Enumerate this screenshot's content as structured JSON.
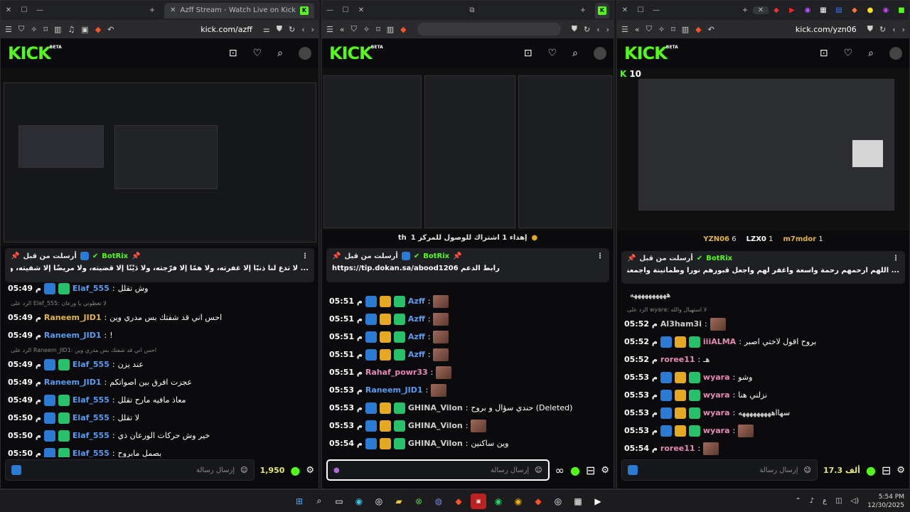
{
  "windows": [
    {
      "tab_title": "Azff Stream - Watch Live on Kick",
      "url": "kick.com/azff",
      "pinned": {
        "label": "أرسلت من قبل",
        "bot": "BotRix",
        "message": "... لا تدع لنا ذنبًا إلا غفرته، ولا همًا إلا فرّجته، ولا دَيْنًا إلا قضيته، ولا مريضًا إلا شفيته، ولا مبتلى إلا عافيته، يا أكرم الأكرمين"
      },
      "chat": [
        {
          "time": "05:49 م",
          "user": "Elaf_555",
          "ucls": "u-blue",
          "badges": [
            "b-blue",
            "b-green"
          ],
          "text": "وش تقلل"
        },
        {
          "reply": "الرد على Elaf_555: لا تعطوني يا ورعان"
        },
        {
          "time": "05:49 م",
          "user": "Raneem_JID1",
          "ucls": "u-gold",
          "badges": [],
          "text": "احس اني قد شفتك بس مدري وين"
        },
        {
          "time": "05:49 م",
          "user": "Raneem_JID1",
          "ucls": "u-blue",
          "badges": [],
          "text": "!"
        },
        {
          "reply": "الرد على Raneem_JID1: احس اني قد شفتك بس مدري وين"
        },
        {
          "time": "05:49 م",
          "user": "Elaf_555",
          "ucls": "u-blue",
          "badges": [
            "b-blue",
            "b-green"
          ],
          "text": "عند يزن"
        },
        {
          "time": "05:49 م",
          "user": "Raneem_JID1",
          "ucls": "u-blue",
          "badges": [],
          "text": "عجزت افرق بين اصواتكم"
        },
        {
          "time": "05:49 م",
          "user": "Elaf_555",
          "ucls": "u-blue",
          "badges": [
            "b-blue",
            "b-green"
          ],
          "text": "معاذ مافيه مارح تقلل"
        },
        {
          "time": "05:50 م",
          "user": "Elaf_555",
          "ucls": "u-blue",
          "badges": [
            "b-blue",
            "b-green"
          ],
          "text": "لا تقلل"
        },
        {
          "time": "05:50 م",
          "user": "Elaf_555",
          "ucls": "u-blue",
          "badges": [
            "b-blue",
            "b-green"
          ],
          "text": "خير وش حركات الورعان ذي"
        },
        {
          "time": "05:50 م",
          "user": "Elaf_555",
          "ucls": "u-blue",
          "badges": [
            "b-blue",
            "b-green"
          ],
          "text": "بصمل مابروح"
        }
      ],
      "input_placeholder": "إرسال رسالة",
      "points": "1,950"
    },
    {
      "goal": "إهداء 1 اشتراك للوصول للمركز 1",
      "goal_suffix": "th",
      "pinned": {
        "label": "أرسلت من قبل",
        "bot": "BotRix",
        "link": "https://tip.dokan.sa/abood1206",
        "link_label": "رابط الدعم"
      },
      "chat": [
        {
          "time": "05:51 م",
          "user": "Azff",
          "ucls": "u-blue",
          "badges": [
            "b-blue",
            "b-gold",
            "b-green"
          ],
          "text": "",
          "thumb": true
        },
        {
          "time": "05:51 م",
          "user": "Azff",
          "ucls": "u-blue",
          "badges": [
            "b-blue",
            "b-gold",
            "b-green"
          ],
          "text": "",
          "thumb": true
        },
        {
          "time": "05:51 م",
          "user": "Azff",
          "ucls": "u-blue",
          "badges": [
            "b-blue",
            "b-gold",
            "b-green"
          ],
          "text": "",
          "thumb": true
        },
        {
          "time": "05:51 م",
          "user": "Azff",
          "ucls": "u-blue",
          "badges": [
            "b-blue",
            "b-gold",
            "b-green"
          ],
          "text": "",
          "thumb": true
        },
        {
          "time": "05:51 م",
          "user": "Rahaf_powr33",
          "ucls": "u-pink",
          "badges": [],
          "text": "",
          "thumb": true
        },
        {
          "time": "05:53 م",
          "user": "Raneem_JID1",
          "ucls": "u-blue",
          "badges": [],
          "text": "",
          "thumb": true
        },
        {
          "time": "05:53 م",
          "user": "GHINA_Vilon",
          "ucls": "u-gray",
          "badges": [
            "b-blue",
            "b-gold",
            "b-green"
          ],
          "text": "حندي سؤال و بروح (Deleted)"
        },
        {
          "time": "05:53 م",
          "user": "GHINA_Vilon",
          "ucls": "u-gray",
          "badges": [
            "b-blue",
            "b-gold",
            "b-green"
          ],
          "text": "",
          "thumb": true
        },
        {
          "time": "05:54 م",
          "user": "GHINA_Vilon",
          "ucls": "u-gray",
          "badges": [
            "b-blue",
            "b-gold",
            "b-green"
          ],
          "text": "وين ساكنين"
        }
      ],
      "input_placeholder": "إرسال رسالة"
    },
    {
      "url": "kick.com/yzn06",
      "viewer_count": "10",
      "top_viewers": [
        {
          "name": "YZN06",
          "count": "6"
        },
        {
          "name": "LZX0",
          "count": "1"
        },
        {
          "name": "m7mdor",
          "count": "1"
        }
      ],
      "pinned": {
        "label": "أرسلت من قبل",
        "bot": "BotRix",
        "message": "... اللهم ارحمهم رحمة واسعة واغفر لهم واجعل قبورهم نوراً وطمأنينة واجمعنا بهم في جناتك بلا حساب ولا عقاب"
      },
      "chat": [
        {
          "time": "",
          "user": "",
          "ucls": "u-gray",
          "badges": [],
          "text": "ههههههههههه"
        },
        {
          "reply": "الرد على wyara: لا استهبال والله"
        },
        {
          "time": "05:52 م",
          "user": "Al3ham3i",
          "ucls": "u-gray",
          "badges": [],
          "text": "",
          "thumb": true
        },
        {
          "time": "05:52 م",
          "user": "iiiALMA",
          "ucls": "u-pink",
          "badges": [
            "b-blue",
            "b-gold",
            "b-green"
          ],
          "text": "بروح اقول لاختي اصبر"
        },
        {
          "time": "05:52 م",
          "user": "roree11",
          "ucls": "u-pink",
          "badges": [],
          "text": "هـ"
        },
        {
          "time": "05:53 م",
          "user": "wyara",
          "ucls": "u-pink",
          "badges": [
            "b-blue",
            "b-gold",
            "b-green"
          ],
          "text": "وشو"
        },
        {
          "time": "05:53 م",
          "user": "wyara",
          "ucls": "u-pink",
          "badges": [
            "b-blue",
            "b-gold",
            "b-green"
          ],
          "text": "نزلني هنا"
        },
        {
          "time": "05:53 م",
          "user": "wyara",
          "ucls": "u-pink",
          "badges": [
            "b-blue",
            "b-gold",
            "b-green"
          ],
          "text": "سهااهههههههههه"
        },
        {
          "time": "05:53 م",
          "user": "wyara",
          "ucls": "u-pink",
          "badges": [
            "b-blue",
            "b-gold",
            "b-green"
          ],
          "text": "",
          "thumb": true
        },
        {
          "time": "05:54 م",
          "user": "roree11",
          "ucls": "u-pink",
          "badges": [],
          "text": "",
          "thumb": true
        }
      ],
      "input_placeholder": "إرسال رسالة",
      "points": "17.3 ألف"
    }
  ],
  "taskbar": {
    "time": "5:54 PM",
    "date": "12/30/2025",
    "lang": "ع"
  },
  "colors": {
    "kick_green": "#53fc18"
  }
}
